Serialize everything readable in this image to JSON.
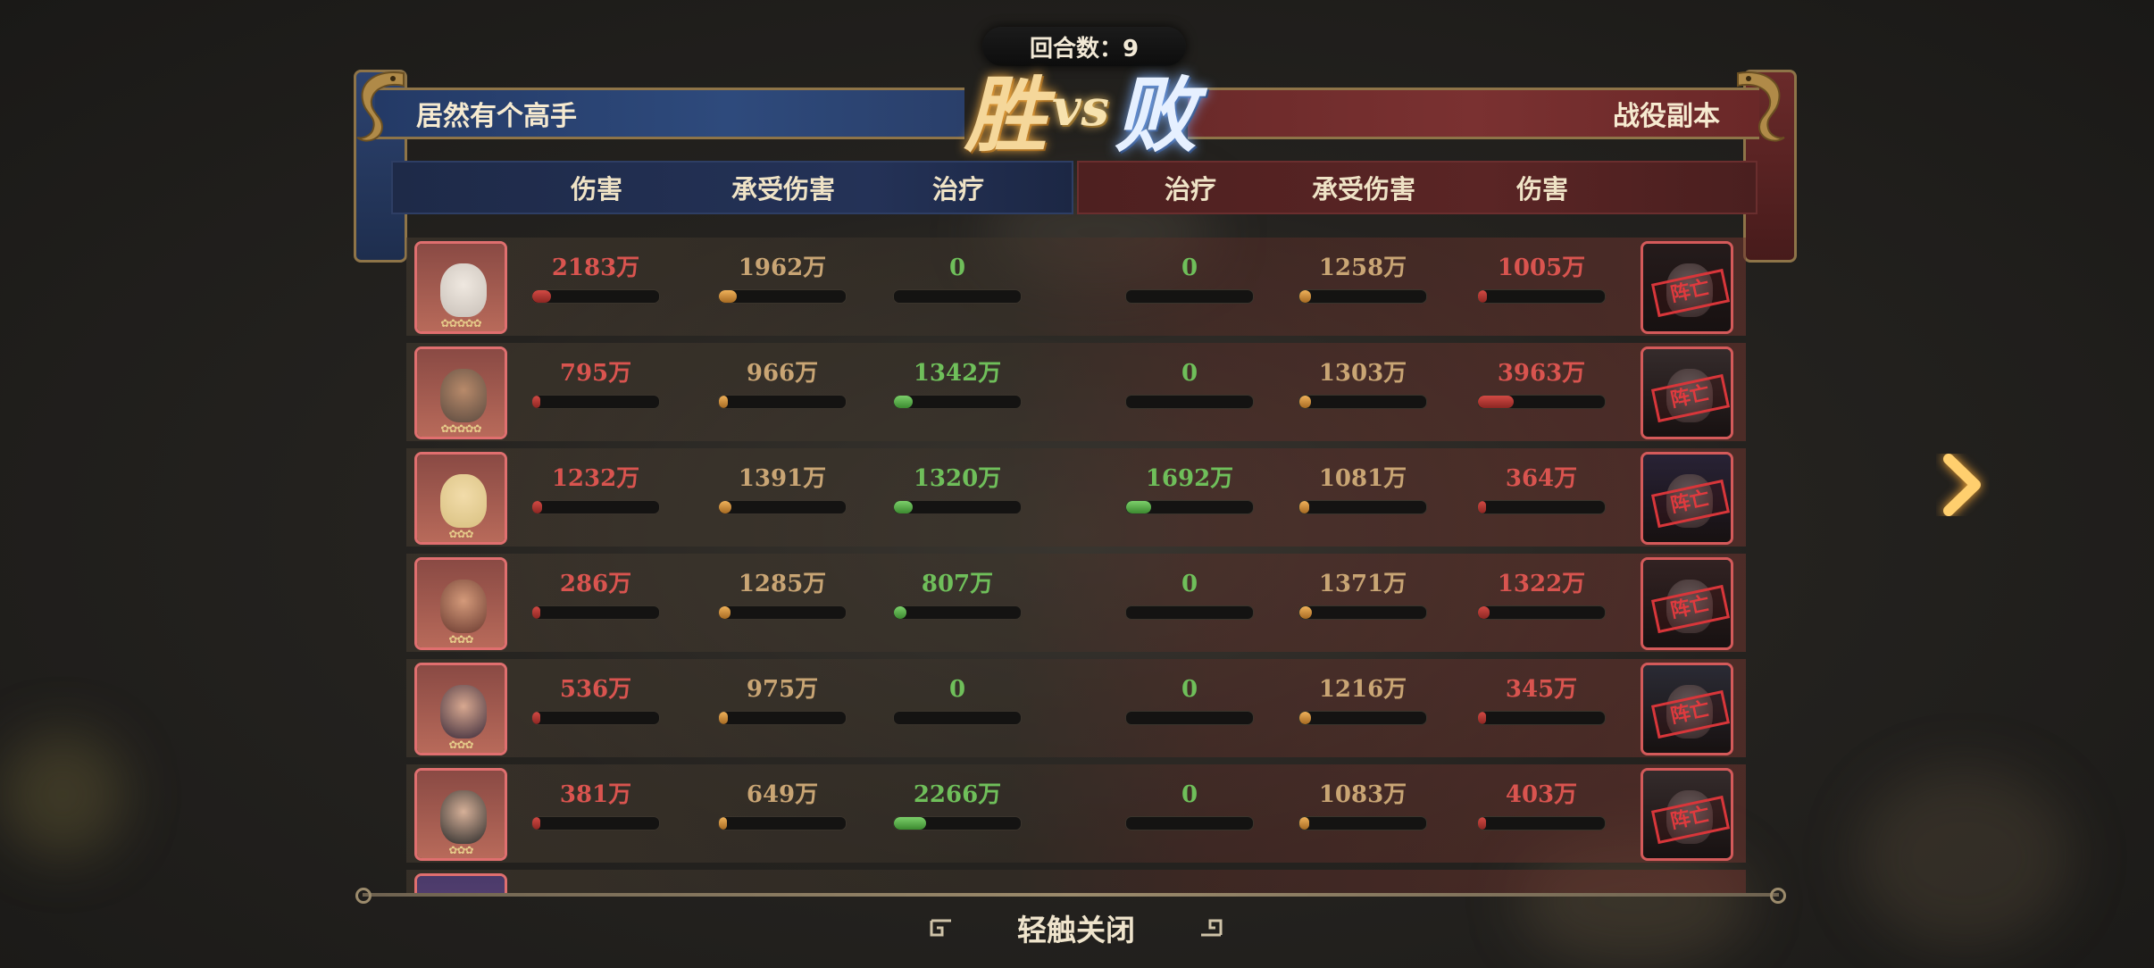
{
  "round": {
    "label": "回合数：9"
  },
  "title": {
    "win": "胜",
    "vs": "vs",
    "lose": "败"
  },
  "left_team": {
    "name": "居然有个高手"
  },
  "right_team": {
    "name": "战役副本"
  },
  "columns": {
    "left": [
      "伤害",
      "承受伤害",
      "治疗"
    ],
    "right": [
      "治疗",
      "承受伤害",
      "伤害"
    ]
  },
  "rows": [
    {
      "left_stars": "✿✿✿✿✿",
      "l_dmg": "2183万",
      "l_dmg_pct": 0.15,
      "l_tak": "1962万",
      "l_tak_pct": 0.14,
      "l_heal": "0",
      "l_heal_pct": 0,
      "r_heal": "0",
      "r_heal_pct": 0,
      "r_tak": "1258万",
      "r_tak_pct": 0.09,
      "r_dmg": "1005万",
      "r_dmg_pct": 0.07,
      "right_stamp": "阵亡"
    },
    {
      "left_stars": "✿✿✿✿✿",
      "l_dmg": "795万",
      "l_dmg_pct": 0.06,
      "l_tak": "966万",
      "l_tak_pct": 0.07,
      "l_heal": "1342万",
      "l_heal_pct": 0.15,
      "r_heal": "0",
      "r_heal_pct": 0,
      "r_tak": "1303万",
      "r_tak_pct": 0.09,
      "r_dmg": "3963万",
      "r_dmg_pct": 0.28,
      "right_stamp": "阵亡"
    },
    {
      "left_stars": "✿✿✿",
      "l_dmg": "1232万",
      "l_dmg_pct": 0.08,
      "l_tak": "1391万",
      "l_tak_pct": 0.1,
      "l_heal": "1320万",
      "l_heal_pct": 0.15,
      "r_heal": "1692万",
      "r_heal_pct": 0.2,
      "r_tak": "1081万",
      "r_tak_pct": 0.08,
      "r_dmg": "364万",
      "r_dmg_pct": 0.03,
      "right_stamp": "阵亡"
    },
    {
      "left_stars": "✿✿✿",
      "l_dmg": "286万",
      "l_dmg_pct": 0.02,
      "l_tak": "1285万",
      "l_tak_pct": 0.09,
      "l_heal": "807万",
      "l_heal_pct": 0.1,
      "r_heal": "0",
      "r_heal_pct": 0,
      "r_tak": "1371万",
      "r_tak_pct": 0.1,
      "r_dmg": "1322万",
      "r_dmg_pct": 0.09,
      "right_stamp": "阵亡"
    },
    {
      "left_stars": "✿✿✿",
      "l_dmg": "536万",
      "l_dmg_pct": 0.04,
      "l_tak": "975万",
      "l_tak_pct": 0.07,
      "l_heal": "0",
      "l_heal_pct": 0,
      "r_heal": "0",
      "r_heal_pct": 0,
      "r_tak": "1216万",
      "r_tak_pct": 0.09,
      "r_dmg": "345万",
      "r_dmg_pct": 0.02,
      "right_stamp": "阵亡"
    },
    {
      "left_stars": "✿✿✿",
      "l_dmg": "381万",
      "l_dmg_pct": 0.03,
      "l_tak": "649万",
      "l_tak_pct": 0.05,
      "l_heal": "2266万",
      "l_heal_pct": 0.25,
      "r_heal": "0",
      "r_heal_pct": 0,
      "r_tak": "1083万",
      "r_tak_pct": 0.08,
      "r_dmg": "403万",
      "r_dmg_pct": 0.03,
      "right_stamp": "阵亡"
    }
  ],
  "footer": {
    "close_label": "轻触关闭"
  },
  "icons": {
    "next": "chevron-right-icon",
    "dragon": "dragon-ornament-icon",
    "knot": "knot-ornament-icon"
  },
  "colors": {
    "damage": "#d9544f",
    "taken": "#c9a574",
    "heal": "#6fbf5a",
    "left_team": "#2e4a7c",
    "right_team": "#7a3131"
  }
}
